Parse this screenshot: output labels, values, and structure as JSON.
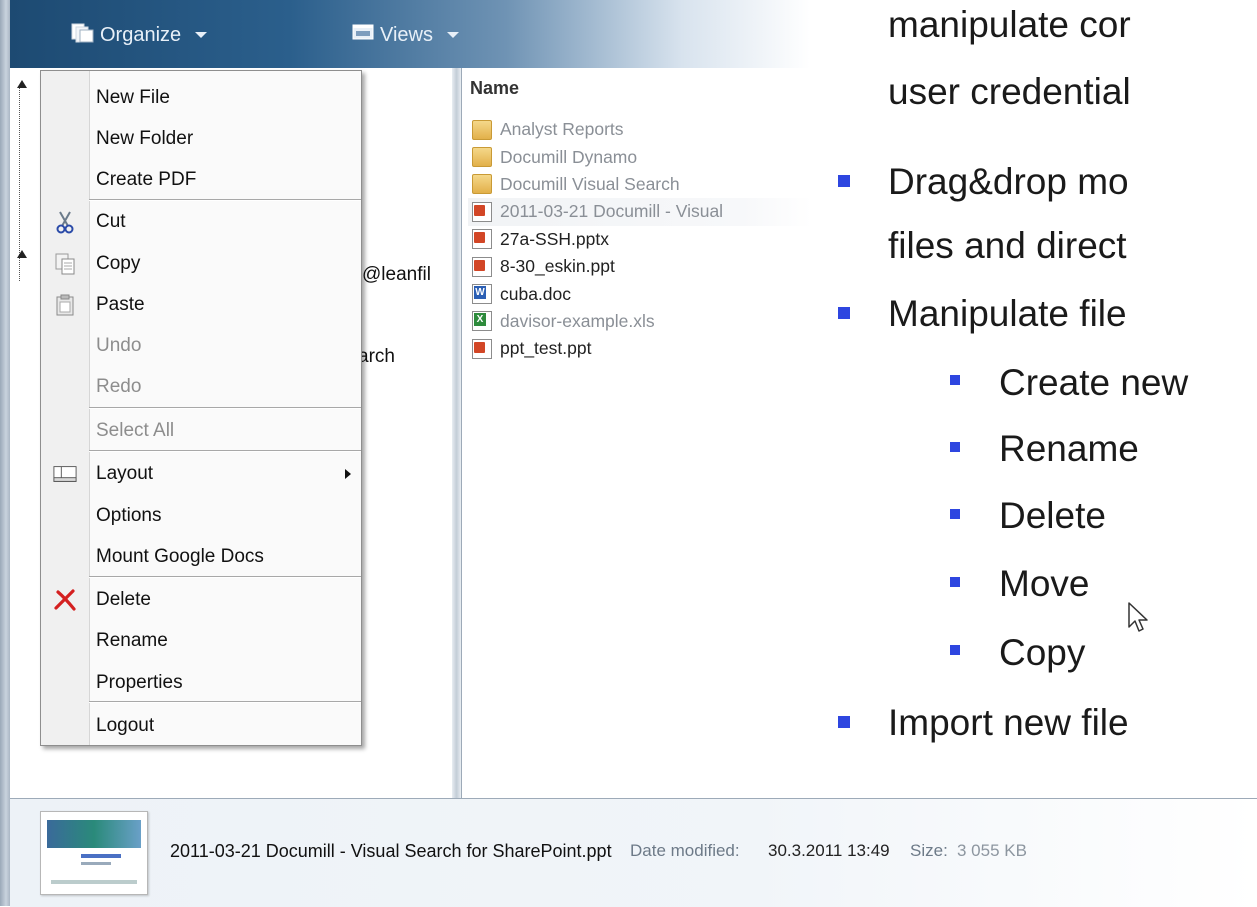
{
  "toolbar": {
    "organize_label": "Organize",
    "views_label": "Views"
  },
  "left_pane": {
    "partial_email": "@leanfil",
    "partial_item": "arch"
  },
  "context_menu": {
    "items": [
      {
        "label": "New File",
        "icon": "",
        "enabled": true
      },
      {
        "label": "New Folder",
        "icon": "",
        "enabled": true
      },
      {
        "label": "Create PDF",
        "icon": "",
        "enabled": true
      },
      {
        "label": "Cut",
        "icon": "scissors-icon",
        "enabled": true
      },
      {
        "label": "Copy",
        "icon": "copy-icon",
        "enabled": true
      },
      {
        "label": "Paste",
        "icon": "paste-icon",
        "enabled": true
      },
      {
        "label": "Undo",
        "icon": "",
        "enabled": false
      },
      {
        "label": "Redo",
        "icon": "",
        "enabled": false
      },
      {
        "label": "Select All",
        "icon": "",
        "enabled": false
      },
      {
        "label": "Layout",
        "icon": "layout-icon",
        "enabled": true,
        "submenu": true
      },
      {
        "label": "Options",
        "icon": "",
        "enabled": true
      },
      {
        "label": "Mount Google Docs",
        "icon": "",
        "enabled": true
      },
      {
        "label": "Delete",
        "icon": "delete-x-icon",
        "enabled": true
      },
      {
        "label": "Rename",
        "icon": "",
        "enabled": true
      },
      {
        "label": "Properties",
        "icon": "",
        "enabled": true
      },
      {
        "label": "Logout",
        "icon": "",
        "enabled": true
      }
    ]
  },
  "file_list": {
    "column_name": "Name",
    "files": [
      {
        "name": "Analyst Reports",
        "type": "folder"
      },
      {
        "name": "Documill Dynamo",
        "type": "folder"
      },
      {
        "name": "Documill Visual Search",
        "type": "folder"
      },
      {
        "name": "2011-03-21 Documill - Visual",
        "type": "ppt"
      },
      {
        "name": "27a-SSH.pptx",
        "type": "ppt"
      },
      {
        "name": "8-30_eskin.ppt",
        "type": "ppt"
      },
      {
        "name": "cuba.doc",
        "type": "doc"
      },
      {
        "name": "davisor-example.xls",
        "type": "xls"
      },
      {
        "name": "ppt_test.ppt",
        "type": "ppt"
      }
    ]
  },
  "status_bar": {
    "file_name": "2011-03-21 Documill - Visual Search for SharePoint.ppt",
    "date_label": "Date modified:",
    "date_value": "30.3.2011 13:49",
    "size_label": "Size:",
    "size_value": "3 055 KB"
  },
  "slide": {
    "line1": "manipulate cor",
    "line2": "user credential",
    "bullet1_line1": "Drag&drop mo",
    "bullet1_line2": "files and direct",
    "bullet2": "Manipulate file",
    "sub_bullets": [
      "Create new",
      "Rename",
      "Delete",
      "Move",
      "Copy"
    ],
    "bullet3": "Import new file"
  },
  "colors": {
    "toolbar_dark": "#1d4a72",
    "bullet_blue": "#2e46e0",
    "delete_red": "#d42020"
  }
}
